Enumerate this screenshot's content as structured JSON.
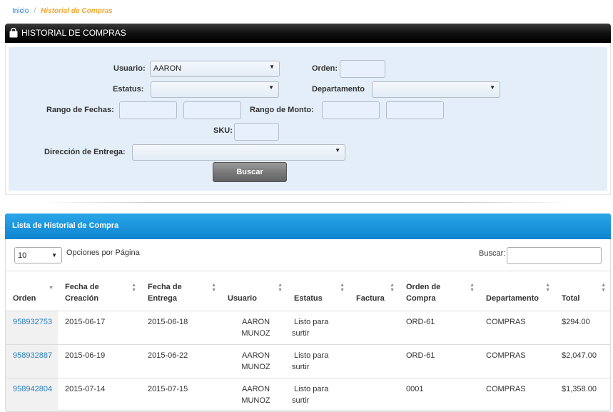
{
  "breadcrumb": {
    "home": "Inicio",
    "separator": "/",
    "current": "Historial de Compras"
  },
  "header": {
    "title": "HISTORIAL DE COMPRAS",
    "icon": "shopping-bag-icon"
  },
  "filters": {
    "usuario_label": "Usuario:",
    "usuario_value": "AARON",
    "orden_label": "Orden:",
    "estatus_label": "Estatus:",
    "departamento_label": "Departamento",
    "fechas_label": "Rango de Fechas:",
    "monto_label": "Rango de Monto:",
    "sku_label": "SKU:",
    "direccion_label": "Dirección de Entrega:",
    "buscar_button": "Buscar"
  },
  "list": {
    "title": "Lista de Historial de Compra",
    "page_size": "10",
    "page_size_label": "Opciones por Página",
    "search_label": "Buscar:",
    "columns": [
      {
        "line1": "",
        "line2": "Orden"
      },
      {
        "line1": "Fecha de",
        "line2": "Creación"
      },
      {
        "line1": "Fecha de",
        "line2": "Entrega"
      },
      {
        "line1": "",
        "line2": "Usuario"
      },
      {
        "line1": "",
        "line2": "Estatus"
      },
      {
        "line1": "",
        "line2": "Factura"
      },
      {
        "line1": "Orden de",
        "line2": "Compra"
      },
      {
        "line1": "",
        "line2": "Departamento"
      },
      {
        "line1": "",
        "line2": "Total"
      }
    ],
    "rows": [
      {
        "orden": "958932753",
        "creacion": "2015-06-17",
        "entrega": "2015-06-18",
        "usuario1": "AARON",
        "usuario2": "MUNOZ",
        "estatus1": "Listo para",
        "estatus2": "surtir",
        "factura": "",
        "orden_compra": "ORD-61",
        "departamento": "COMPRAS",
        "total": "$294.00"
      },
      {
        "orden": "958932887",
        "creacion": "2015-06-19",
        "entrega": "2015-06-22",
        "usuario1": "AARON",
        "usuario2": "MUNOZ",
        "estatus1": "Listo para",
        "estatus2": "surtir",
        "factura": "",
        "orden_compra": "ORD-61",
        "departamento": "COMPRAS",
        "total": "$2,047.00"
      },
      {
        "orden": "958942804",
        "creacion": "2015-07-14",
        "entrega": "2015-07-15",
        "usuario1": "AARON",
        "usuario2": "MUNOZ",
        "estatus1": "Listo para",
        "estatus2": "surtir",
        "factura": "",
        "orden_compra": "0001",
        "departamento": "COMPRAS",
        "total": "$1,358.00"
      }
    ]
  }
}
